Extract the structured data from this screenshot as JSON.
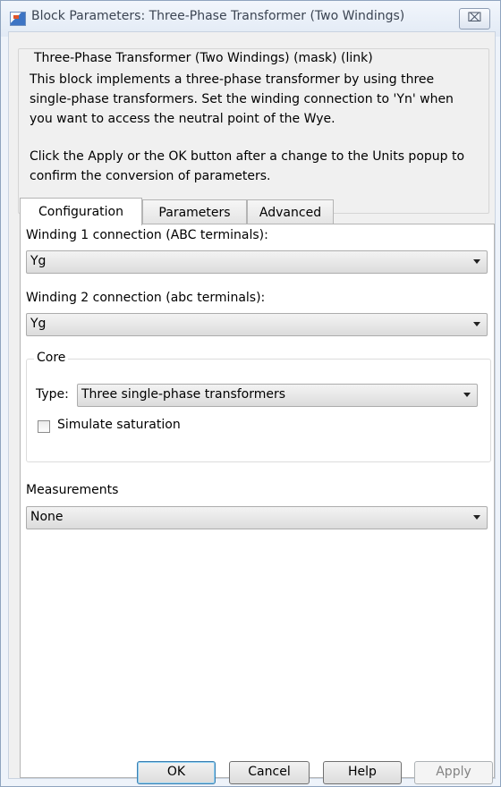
{
  "window": {
    "title": "Block Parameters: Three-Phase Transformer (Two Windings)",
    "close_symbol": "⌧"
  },
  "mask": {
    "header": "Three-Phase Transformer (Two Windings) (mask) (link)",
    "description_lines": [
      "This block implements a three-phase transformer by using three",
      "single-phase transformers. Set the winding connection to 'Yn'  when",
      "you want to access the neutral point of the Wye."
    ],
    "note_lines": [
      "Click the Apply or the OK button after a change to the Units popup to",
      "confirm the conversion of parameters."
    ]
  },
  "tabs": [
    {
      "label": "Configuration",
      "active": true
    },
    {
      "label": "Parameters",
      "active": false
    },
    {
      "label": "Advanced",
      "active": false
    }
  ],
  "config": {
    "winding1_label": "Winding 1 connection (ABC terminals):",
    "winding1_value": "Yg",
    "winding2_label": "Winding 2 connection (abc terminals):",
    "winding2_value": "Yg",
    "core_legend": "Core",
    "core_type_label": "Type:",
    "core_type_value": "Three single-phase transformers",
    "simulate_saturation_label": "Simulate saturation",
    "simulate_saturation_checked": false,
    "measurements_label": "Measurements",
    "measurements_value": "None"
  },
  "buttons": {
    "ok": "OK",
    "cancel": "Cancel",
    "help": "Help",
    "apply": "Apply"
  }
}
